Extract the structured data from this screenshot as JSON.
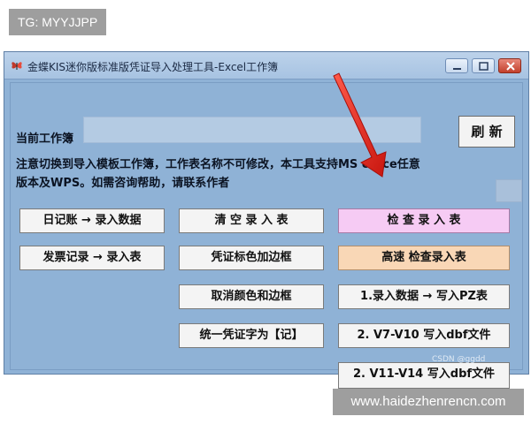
{
  "top_tag": "TG: MYYJJPP",
  "bottom_tag": "www.haidezhenrencn.com",
  "window": {
    "title": "金蝶KIS迷你版标准版凭证导入处理工具-Excel工作簿",
    "controls": [
      "minimize",
      "maximize",
      "close"
    ]
  },
  "form": {
    "workbook_label": "当前工作簿",
    "workbook_value": "",
    "refresh_label": "刷 新",
    "notice_line1": "注意切换到导入模板工作簿，工作表名称不可修改，本工具支持MS office任意",
    "notice_line2": "版本及WPS。如需咨询帮助，请联系作者"
  },
  "buttons": {
    "journal": "日记账 → 录入数据",
    "invoice": "发票记录 → 录入表",
    "clear": "清 空 录 入 表",
    "mark_border": "凭证标色加边框",
    "remove_color": "取消颜色和边框",
    "unify_word": "统一凭证字为【记】",
    "check": "检 查 录 入 表",
    "fast_check": "高速 检查录入表",
    "write_pz": "1.录入数据 → 写入PZ表",
    "v7_v10": "2. V7-V10 写入dbf文件",
    "v11_v14": "2. V11-V14 写入dbf文件"
  },
  "watermark": "CSDN @ggdd",
  "colors": {
    "window_bg": "#8fb2d6",
    "check_button": "#f6cbf4",
    "fast_check_button": "#f9d7b6",
    "arrow": "#e02020"
  }
}
